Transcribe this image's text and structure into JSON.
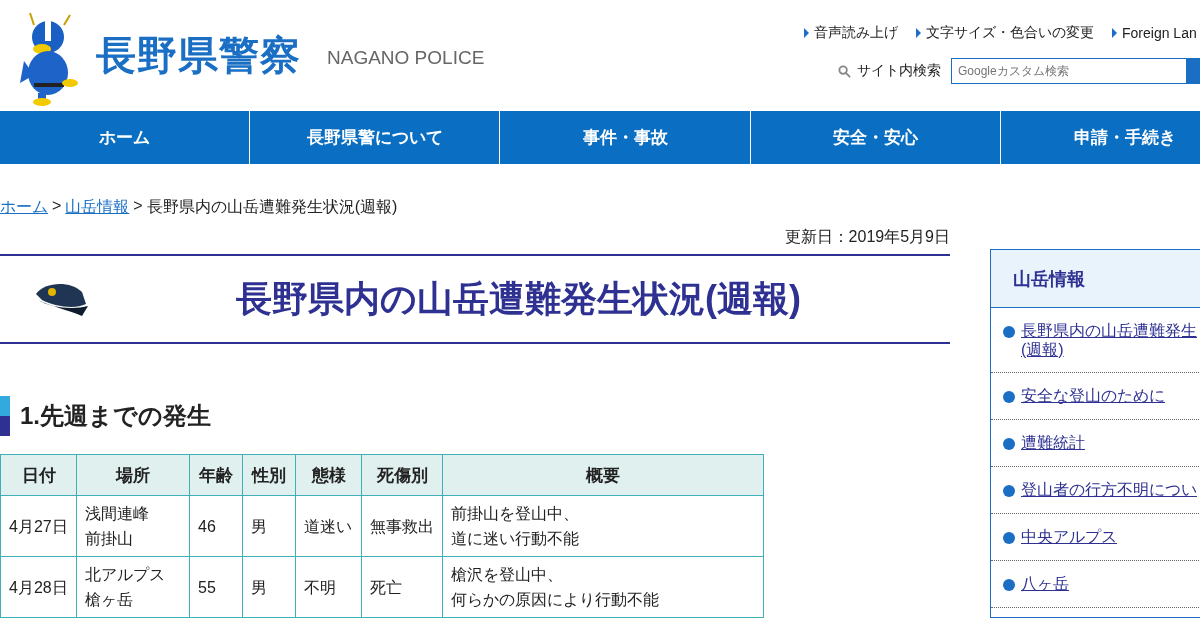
{
  "header": {
    "logo_text": "長野県警察",
    "logo_subtext": "NAGANO POLICE",
    "utility_links": [
      "音声読み上げ",
      "文字サイズ・色合いの変更",
      "Foreign Lan"
    ],
    "search": {
      "label": "サイト内検索",
      "placeholder": "Googleカスタム検索"
    }
  },
  "nav": [
    {
      "label": "ホーム"
    },
    {
      "label": "長野県警について"
    },
    {
      "label": "事件・事故"
    },
    {
      "label": "安全・安心"
    },
    {
      "label": "申請・手続き"
    }
  ],
  "breadcrumb": {
    "links": [
      "ホーム",
      "山岳情報"
    ],
    "separator": ">",
    "current": "長野県内の山岳遭難発生状況(週報)"
  },
  "updated": "更新日：2019年5月9日",
  "title": "長野県内の山岳遭難発生状況(週報)",
  "section_heading": "1.先週までの発生",
  "table": {
    "columns": [
      "日付",
      "場所",
      "年齢",
      "性別",
      "態様",
      "死傷別",
      "概要"
    ],
    "rows": [
      {
        "cells": [
          [
            "4月27日"
          ],
          [
            "浅間連峰",
            "前掛山"
          ],
          [
            "46"
          ],
          [
            "男"
          ],
          [
            "道迷い"
          ],
          [
            "無事救出"
          ],
          [
            "前掛山を登山中、",
            "道に迷い行動不能"
          ]
        ]
      },
      {
        "cells": [
          [
            "4月28日"
          ],
          [
            "北アルプス",
            "槍ヶ岳"
          ],
          [
            "55"
          ],
          [
            "男"
          ],
          [
            "不明"
          ],
          [
            "死亡"
          ],
          [
            "槍沢を登山中、",
            "何らかの原因により行動不能"
          ]
        ]
      }
    ]
  },
  "sidebar": {
    "title": "山岳情報",
    "items": [
      {
        "lines": [
          "長野県内の山岳遭難発生",
          "(週報)"
        ]
      },
      {
        "lines": [
          "安全な登山のために"
        ]
      },
      {
        "lines": [
          "遭難統計"
        ]
      },
      {
        "lines": [
          "登山者の行方不明につい"
        ]
      },
      {
        "lines": [
          "中央アルプス"
        ]
      },
      {
        "lines": [
          "八ヶ岳"
        ]
      }
    ]
  }
}
